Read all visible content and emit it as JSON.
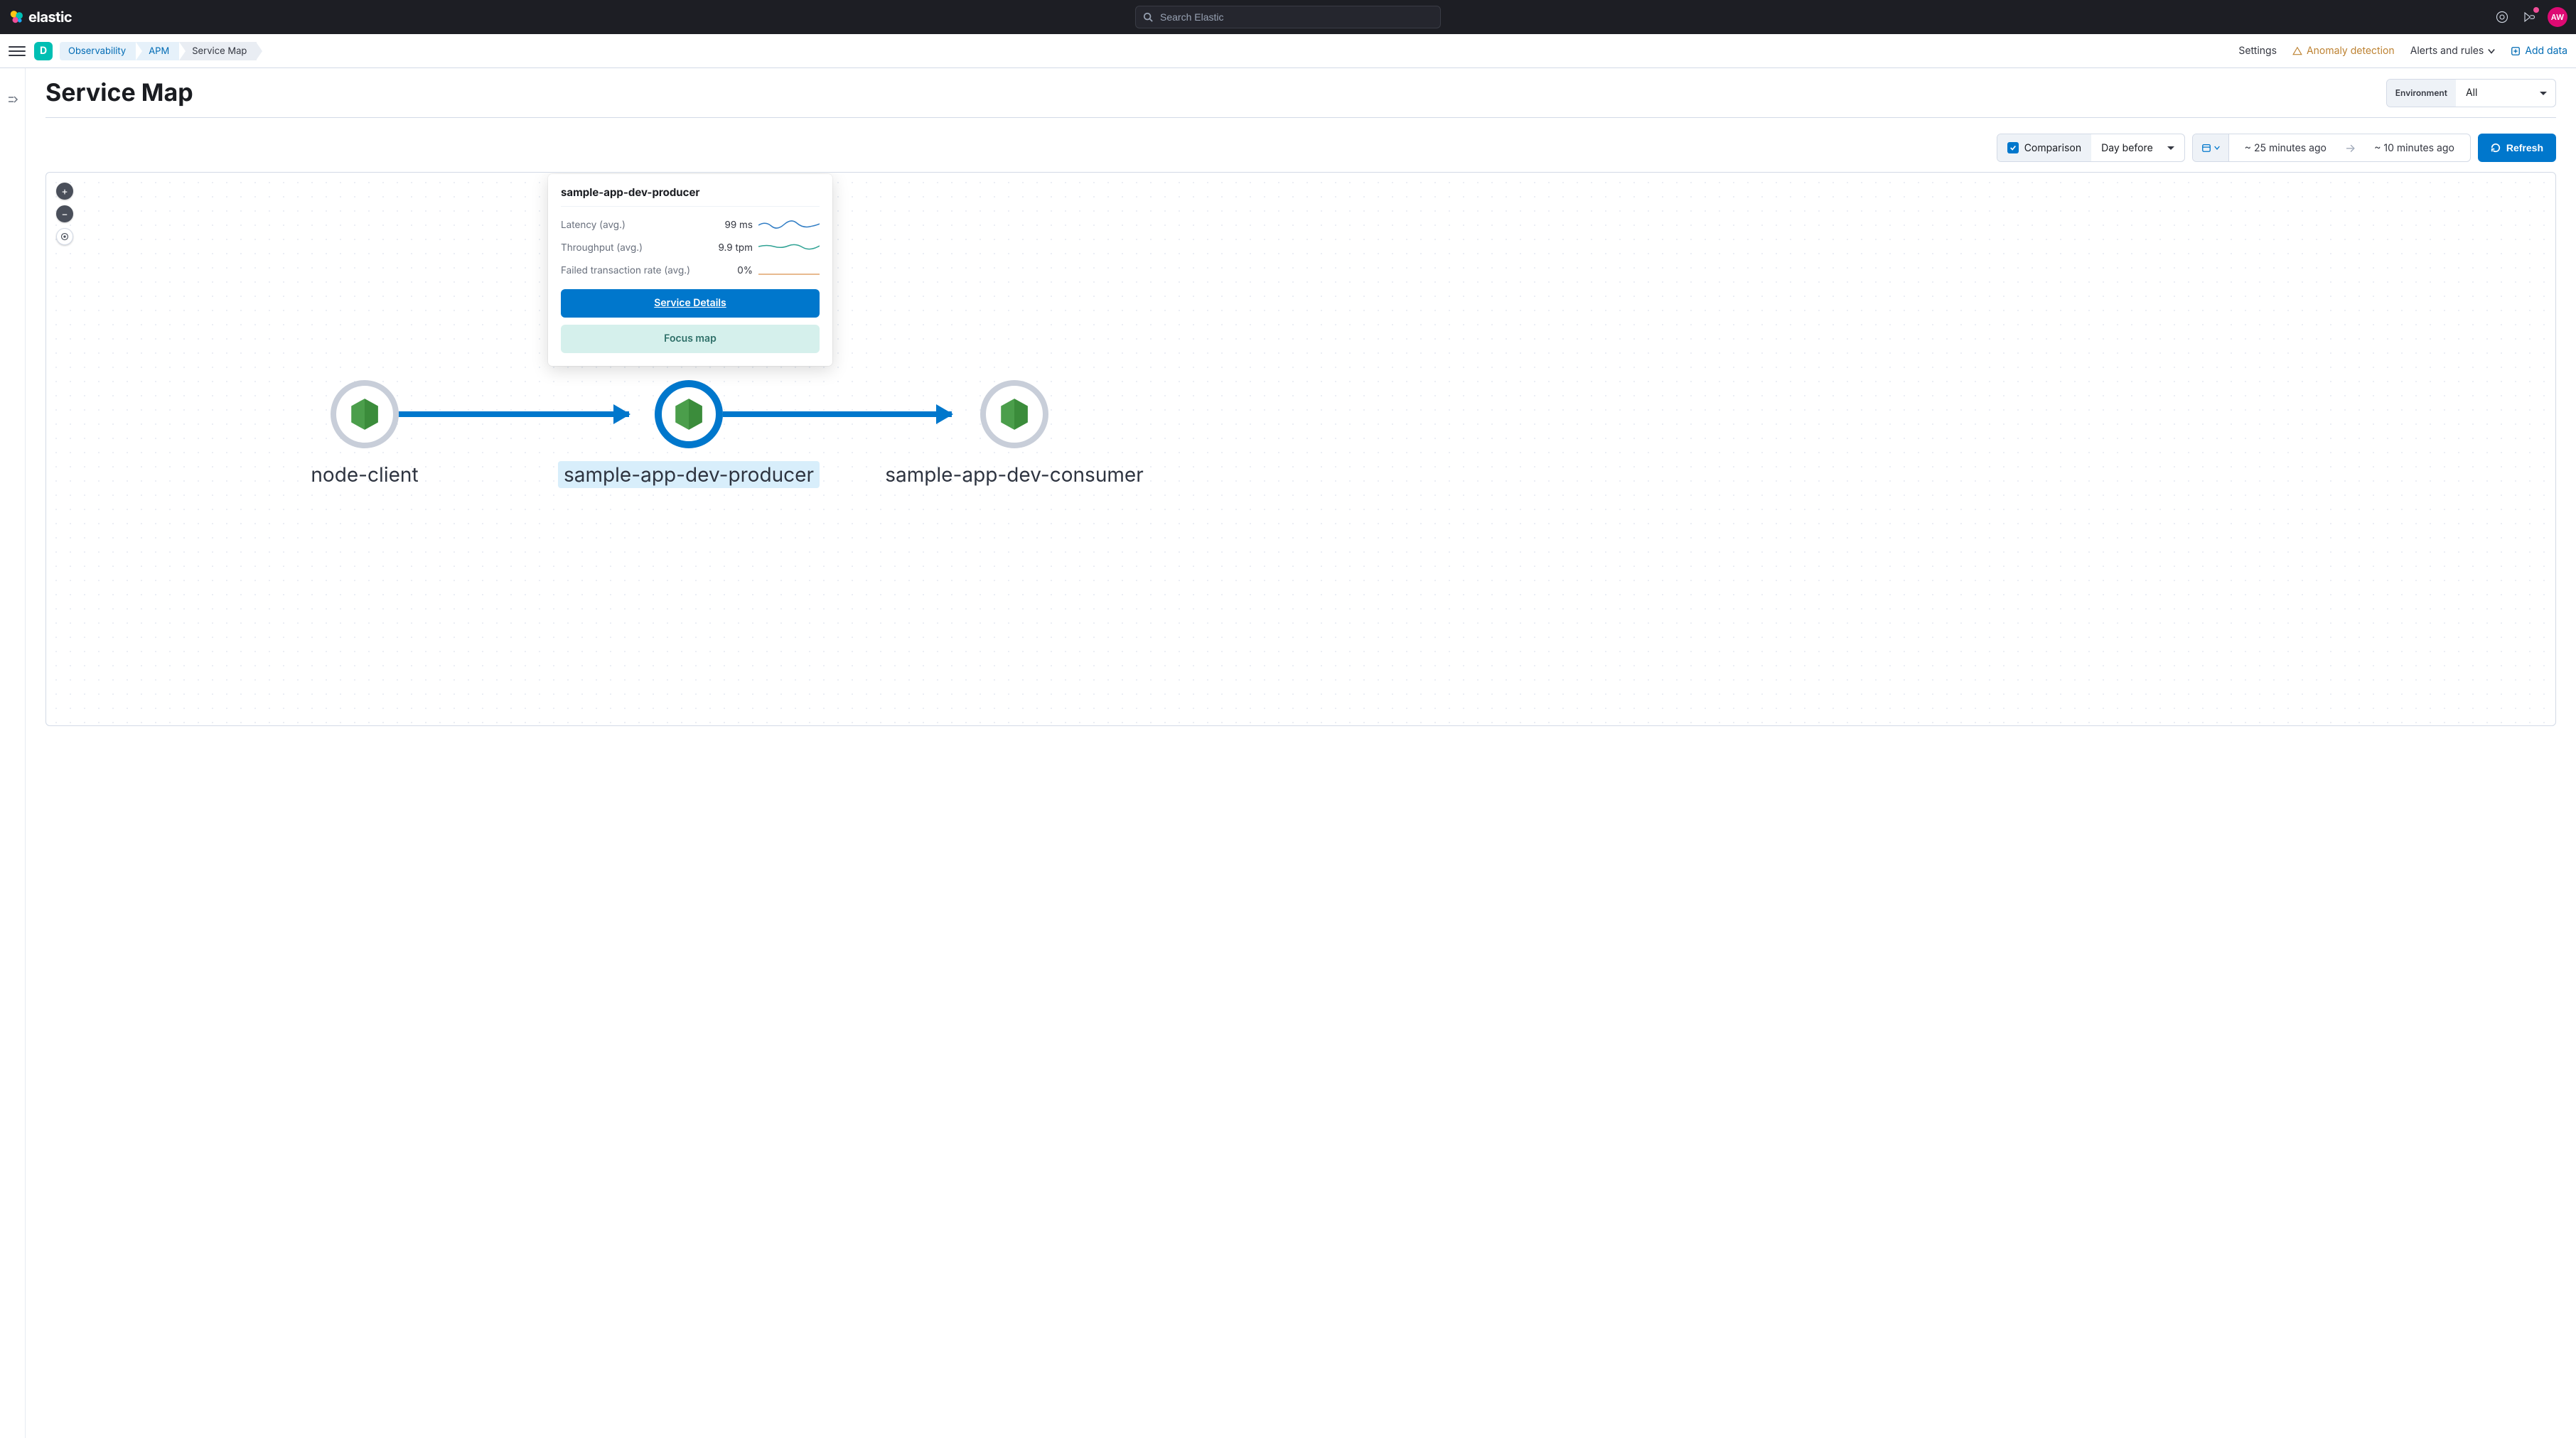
{
  "header": {
    "brand": "elastic",
    "search_placeholder": "Search Elastic",
    "avatar_initials": "AW"
  },
  "secondary": {
    "space_letter": "D",
    "breadcrumbs": [
      "Observability",
      "APM",
      "Service Map"
    ],
    "links": {
      "settings": "Settings",
      "anomaly": "Anomaly detection",
      "alerts": "Alerts and rules",
      "add_data": "Add data"
    }
  },
  "page": {
    "title": "Service Map",
    "environment_label": "Environment",
    "environment_value": "All"
  },
  "toolbar": {
    "comparison_label": "Comparison",
    "comparison_select": "Day before",
    "range_from": "~ 25 minutes ago",
    "range_to": "~ 10 minutes ago",
    "refresh_label": "Refresh"
  },
  "graph": {
    "nodes": [
      {
        "id": "node-client",
        "label": "node-client",
        "selected": false
      },
      {
        "id": "sample-app-dev-producer",
        "label": "sample-app-dev-producer",
        "selected": true
      },
      {
        "id": "sample-app-dev-consumer",
        "label": "sample-app-dev-consumer",
        "selected": false
      }
    ]
  },
  "popover": {
    "title": "sample-app-dev-producer",
    "metrics": {
      "latency_label": "Latency (avg.)",
      "latency_value": "99 ms",
      "throughput_label": "Throughput (avg.)",
      "throughput_value": "9.9 tpm",
      "failrate_label": "Failed transaction rate (avg.)",
      "failrate_value": "0%"
    },
    "buttons": {
      "details": "Service Details",
      "focus": "Focus map"
    }
  }
}
